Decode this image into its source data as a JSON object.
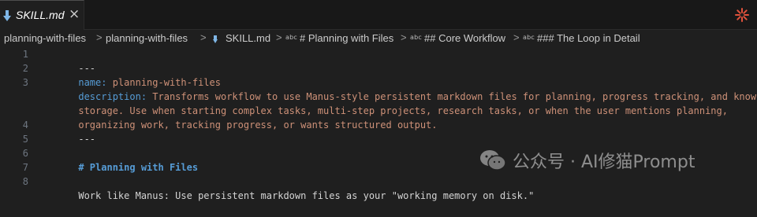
{
  "tab": {
    "icon": "arrow-down-icon",
    "label": "SKILL.md",
    "close_glyph": "×"
  },
  "toolbar": {
    "ai_icon": "sparkle-icon"
  },
  "breadcrumb": {
    "items": [
      "planning-with-files",
      "planning-with-files",
      "SKILL.md",
      "# Planning with Files",
      "## Core Workflow",
      "### The Loop in Detail"
    ],
    "symbol_label": "abc",
    "separator": ">"
  },
  "editor": {
    "line_numbers": [
      "1",
      "2",
      "3",
      "",
      "",
      "4",
      "5",
      "6",
      "7",
      "8"
    ],
    "lines": {
      "l1": "---",
      "l2_key": "name:",
      "l2_val": " planning-with-files",
      "l3_key": "description:",
      "l3_val": " Transforms workflow to use Manus-style persistent markdown files for planning, progress tracking, and knowledge",
      "l3_wrap1": "storage. Use when starting complex tasks, multi-step projects, research tasks, or when the user mentions planning,",
      "l3_wrap2": "organizing work, tracking progress, or wants structured output.",
      "l4": "---",
      "l5": "",
      "l6": "# Planning with Files",
      "l7": "",
      "l8": "Work like Manus: Use persistent markdown files as your \"working memory on disk.\""
    }
  },
  "watermark": {
    "logo": "wechat-logo",
    "text": "公众号 · AI修猫Prompt"
  },
  "colors": {
    "background": "#1f1f1f",
    "tabbar": "#181818",
    "yaml_key": "#569cd6",
    "yaml_value": "#ce9178",
    "heading": "#569cd6",
    "text": "#d4d4d4",
    "line_number": "#6e7681",
    "ai_icon": "#e0523c"
  }
}
